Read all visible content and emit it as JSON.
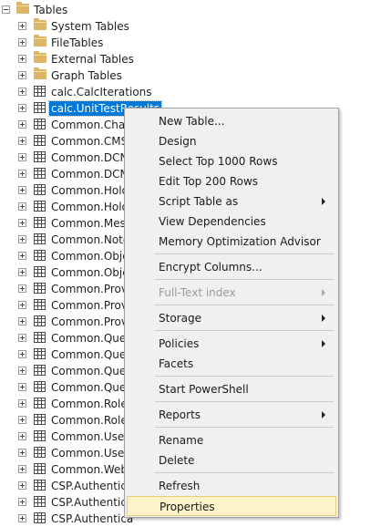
{
  "tree": {
    "root": {
      "label": "Tables",
      "expanded": true,
      "icon": "folder-icon"
    },
    "folders": [
      {
        "label": "System Tables"
      },
      {
        "label": "FileTables"
      },
      {
        "label": "External Tables"
      },
      {
        "label": "Graph Tables"
      }
    ],
    "tables": [
      {
        "label": "calc.CalcIterations",
        "selected": false
      },
      {
        "label": "calc.UnitTestResults",
        "selected": true
      },
      {
        "label": "Common.Chan",
        "selected": false
      },
      {
        "label": "Common.CMS_",
        "selected": false
      },
      {
        "label": "Common.DCNS",
        "selected": false
      },
      {
        "label": "Common.DCNS",
        "selected": false
      },
      {
        "label": "Common.Hold",
        "selected": false
      },
      {
        "label": "Common.Hold",
        "selected": false
      },
      {
        "label": "Common.Mess",
        "selected": false
      },
      {
        "label": "Common.Note",
        "selected": false
      },
      {
        "label": "Common.Obje",
        "selected": false
      },
      {
        "label": "Common.Obje",
        "selected": false
      },
      {
        "label": "Common.Provi",
        "selected": false
      },
      {
        "label": "Common.Provi",
        "selected": false
      },
      {
        "label": "Common.Provi",
        "selected": false
      },
      {
        "label": "Common.Queu",
        "selected": false
      },
      {
        "label": "Common.Queu",
        "selected": false
      },
      {
        "label": "Common.Queu",
        "selected": false
      },
      {
        "label": "Common.Queu",
        "selected": false
      },
      {
        "label": "Common.Role",
        "selected": false
      },
      {
        "label": "Common.RoleC",
        "selected": false
      },
      {
        "label": "Common.User",
        "selected": false
      },
      {
        "label": "Common.UserF",
        "selected": false
      },
      {
        "label": "Common.WebS",
        "selected": false
      },
      {
        "label": "CSP.Authentica",
        "selected": false
      },
      {
        "label": "CSP.Authentica",
        "selected": false
      },
      {
        "label": "CSP.Authentica",
        "selected": false
      }
    ]
  },
  "context_menu": {
    "items": [
      {
        "label": "New Table...",
        "submenu": false,
        "disabled": false
      },
      {
        "label": "Design",
        "submenu": false,
        "disabled": false
      },
      {
        "label": "Select Top 1000 Rows",
        "submenu": false,
        "disabled": false
      },
      {
        "label": "Edit Top 200 Rows",
        "submenu": false,
        "disabled": false
      },
      {
        "label": "Script Table as",
        "submenu": true,
        "disabled": false
      },
      {
        "label": "View Dependencies",
        "submenu": false,
        "disabled": false
      },
      {
        "label": "Memory Optimization Advisor",
        "submenu": false,
        "disabled": false,
        "separator_after": true
      },
      {
        "label": "Encrypt Columns...",
        "submenu": false,
        "disabled": false,
        "separator_after": true
      },
      {
        "label": "Full-Text index",
        "submenu": true,
        "disabled": true,
        "separator_after": true
      },
      {
        "label": "Storage",
        "submenu": true,
        "disabled": false,
        "separator_after": true
      },
      {
        "label": "Policies",
        "submenu": true,
        "disabled": false
      },
      {
        "label": "Facets",
        "submenu": false,
        "disabled": false,
        "separator_after": true
      },
      {
        "label": "Start PowerShell",
        "submenu": false,
        "disabled": false,
        "separator_after": true
      },
      {
        "label": "Reports",
        "submenu": true,
        "disabled": false,
        "separator_after": true
      },
      {
        "label": "Rename",
        "submenu": false,
        "disabled": false
      },
      {
        "label": "Delete",
        "submenu": false,
        "disabled": false,
        "separator_after": true
      },
      {
        "label": "Refresh",
        "submenu": false,
        "disabled": false
      },
      {
        "label": "Properties",
        "submenu": false,
        "disabled": false,
        "highlighted": true
      }
    ]
  },
  "colors": {
    "selection": "#0078d7",
    "menu_background": "#f0f0f0",
    "menu_highlight": "#fcf3c9",
    "folder": "#dcb567"
  }
}
